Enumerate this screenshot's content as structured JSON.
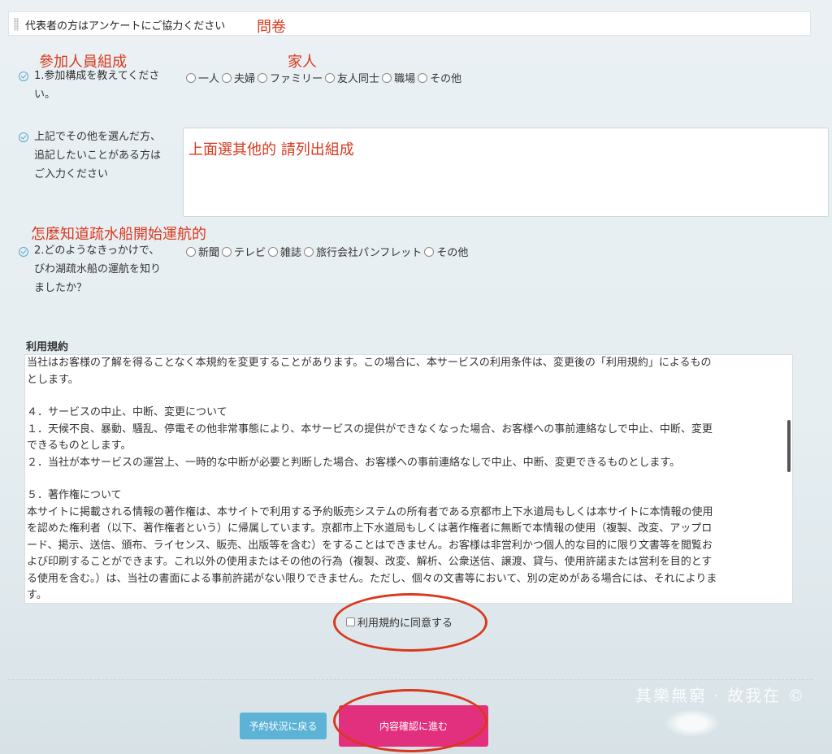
{
  "survey": {
    "title": "代表者の方はアンケートにご協力ください",
    "title_annotation": "問卷",
    "q1": {
      "annotation_left": "參加人員組成",
      "annotation_right": "家人",
      "label_line1": "1.参加構成を教えてくださ",
      "label_line2": "い。",
      "options": [
        "一人",
        "夫婦",
        "ファミリー",
        "友人同士",
        "職場",
        "その他"
      ]
    },
    "other": {
      "label_line1": "上記でその他を選んだ方、",
      "label_line2": "追記したいことがある方は",
      "label_line3": "ご入力ください",
      "textarea_annotation": "上面選其他的 請列出組成"
    },
    "q2": {
      "annotation": "怎麼知道疏水船開始運航的",
      "label_line1": "2.どのようなきっかけで、",
      "label_line2": "びわ湖疏水船の運航を知り",
      "label_line3": "ましたか？",
      "options": [
        "新聞",
        "テレビ",
        "雑誌",
        "旅行会社パンフレット",
        "その他"
      ]
    }
  },
  "terms": {
    "heading": "利用規約",
    "lines": [
      "当社はお客様の了解を得ることなく本規約を変更することがあります。この場合に、本サービスの利用条件は、変更後の「利用規約」によるもの",
      "とします。",
      "",
      "４．サービスの中止、中断、変更について",
      "１．天候不良、暴動、騒乱、停電その他非常事態により、本サービスの提供ができなくなった場合、お客様への事前連絡なしで中止、中断、変更",
      "できるものとします。",
      "２．当社が本サービスの運営上、一時的な中断が必要と判断した場合、お客様への事前連絡なしで中止、中断、変更できるものとします。",
      "",
      "５．著作権について",
      "本サイトに掲載される情報の著作権は、本サイトで利用する予約販売システムの所有者である京都市上下水道局もしくは本サイトに本情報の使用",
      "を認めた権利者（以下、著作権者という）に帰属しています。京都市上下水道局もしくは著作権者に無断で本情報の使用（複製、改変、アップロ",
      "ード、掲示、送信、頒布、ライセンス、販売、出版等を含む）をすることはできません。お客様は非営利かつ個人的な目的に限り文書等を閲覧お",
      "よび印刷することができます。これ以外の使用またはその他の行為（複製、改変、解析、公衆送信、譲渡、貸与、使用許諾または営利を目的とす",
      "る使用を含む。）は、当社の書面による事前許諾がない限りできません。ただし、個々の文書等において、別の定めがある場合には、それによりま",
      "す。"
    ],
    "agree_label": "利用規約に同意する"
  },
  "actions": {
    "back_label": "予約状況に戻る",
    "next_label": "内容確認に進む"
  },
  "watermark": "其樂無窮 · 故我在 ©",
  "colors": {
    "annotation": "#d9381e",
    "back_button": "#5cb3d6",
    "next_button": "#e2307e",
    "check_icon": "#5aa8c8"
  }
}
